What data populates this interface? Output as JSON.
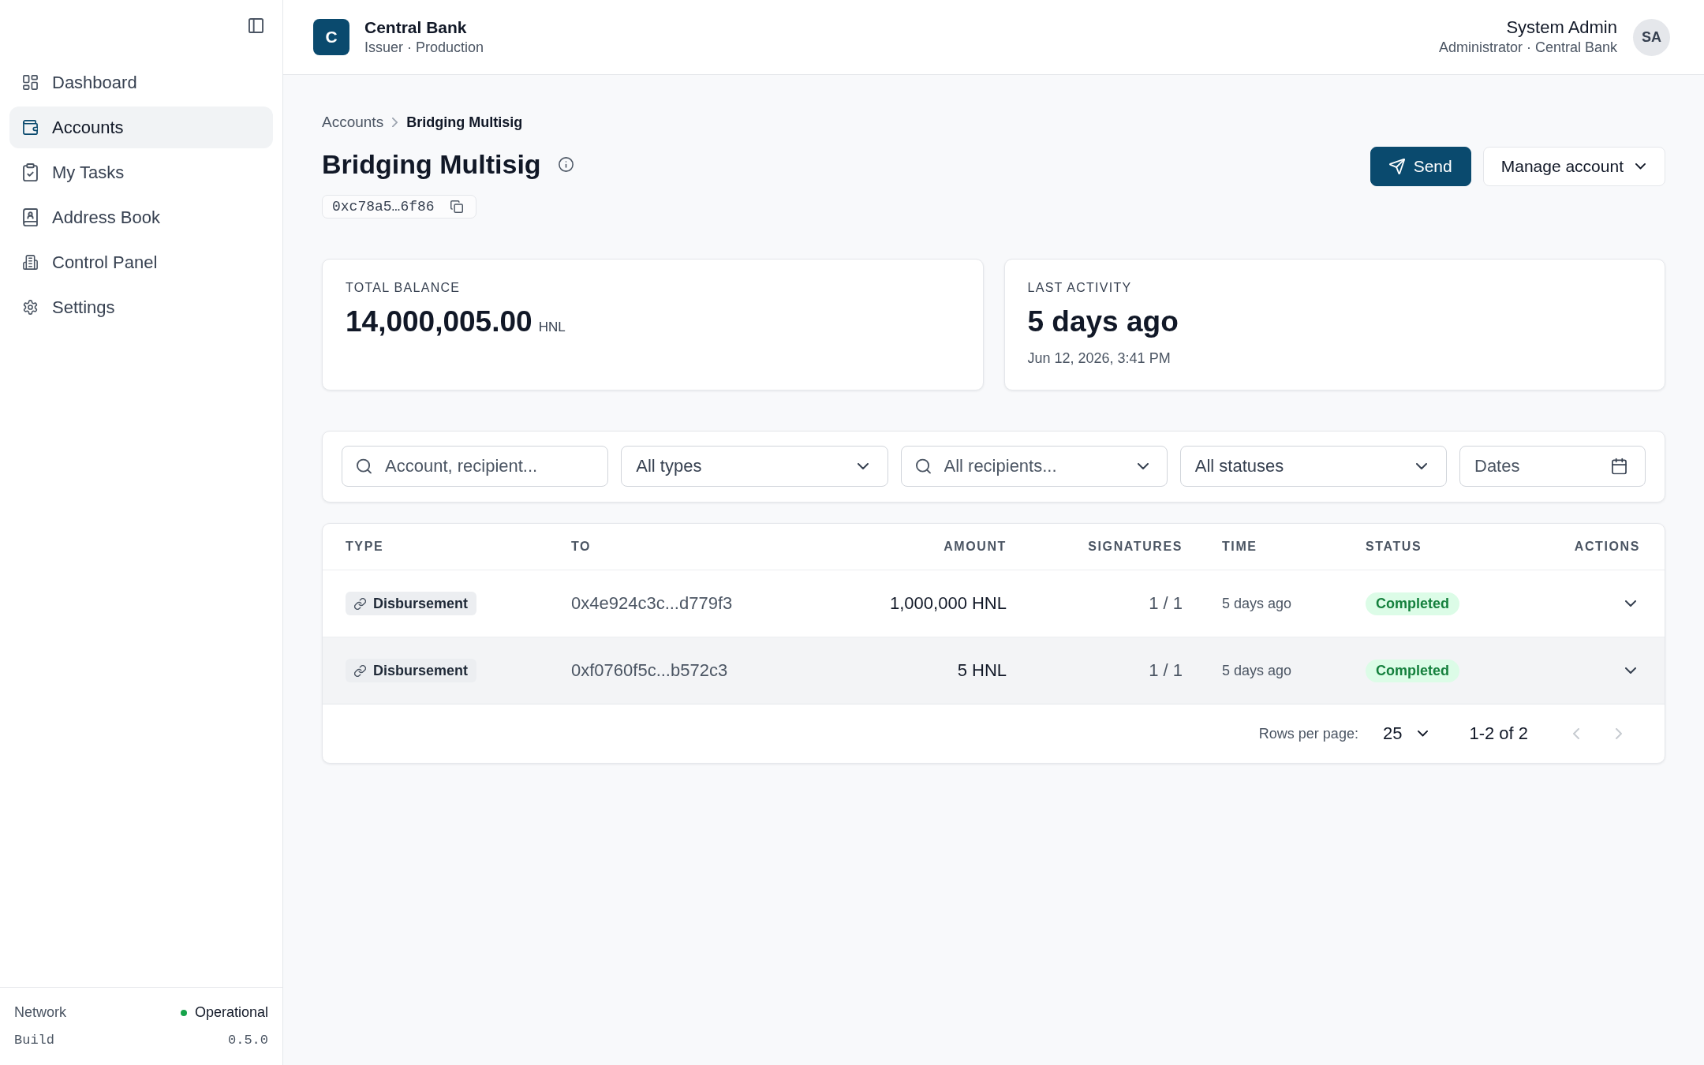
{
  "sidebar": {
    "items": [
      {
        "label": "Dashboard",
        "selected": false
      },
      {
        "label": "Accounts",
        "selected": true
      },
      {
        "label": "My Tasks",
        "selected": false
      },
      {
        "label": "Address Book",
        "selected": false
      },
      {
        "label": "Control Panel",
        "selected": false
      },
      {
        "label": "Settings",
        "selected": false
      }
    ],
    "footer": [
      {
        "kind": "status",
        "label": "Network",
        "value": "Operational"
      },
      {
        "kind": "version",
        "label": "Build",
        "value": "0.5.0"
      }
    ]
  },
  "header": {
    "org": {
      "initial": "C",
      "name": "Central Bank",
      "subtitle": "Issuer · Production"
    },
    "user": {
      "name": "System Admin",
      "role": "Administrator · Central Bank",
      "initials": "SA"
    }
  },
  "breadcrumb": [
    {
      "label": "Accounts",
      "current": false
    },
    {
      "label": "Bridging Multisig",
      "current": true
    }
  ],
  "title": "Bridging Multisig",
  "address": "0xc78a5…6f86",
  "actions": [
    {
      "kind": "primary",
      "label": "Send"
    },
    {
      "kind": "menu",
      "label": "Manage account"
    }
  ],
  "stats": [
    {
      "label": "TOTAL BALANCE",
      "value": "14,000,005.00",
      "unit": "HNL"
    },
    {
      "label": "LAST ACTIVITY",
      "value": "5 days ago",
      "detail": "Jun 12, 2026, 3:41 PM"
    }
  ],
  "filters": [
    {
      "kind": "search",
      "placeholder": "Account, recipient..."
    },
    {
      "kind": "select",
      "value": "All types"
    },
    {
      "kind": "combobox",
      "placeholder": "All recipients..."
    },
    {
      "kind": "select",
      "value": "All statuses"
    },
    {
      "kind": "date",
      "placeholder": "Dates"
    }
  ],
  "table": {
    "columns": [
      "TYPE",
      "TO",
      "AMOUNT",
      "SIGNATURES",
      "TIME",
      "STATUS",
      "ACTIONS"
    ],
    "rows": [
      {
        "type": "Disbursement",
        "to": "0x4e924c3c...d779f3",
        "amount": "1,000,000 HNL",
        "signatures": "1 / 1",
        "time": "5 days ago",
        "status": {
          "label": "Completed",
          "kind": "success"
        },
        "expanded": false,
        "hovered": false
      },
      {
        "type": "Disbursement",
        "to": "0xf0760f5c...b572c3",
        "amount": "5 HNL",
        "signatures": "1 / 1",
        "time": "5 days ago",
        "status": {
          "label": "Completed",
          "kind": "success"
        },
        "expanded": false,
        "hovered": true
      }
    ],
    "pagination": {
      "label": "Rows per page:",
      "page_size": "25",
      "range": "1-2 of 2",
      "previous": {
        "disabled": true
      },
      "next": {
        "disabled": true
      }
    }
  }
}
